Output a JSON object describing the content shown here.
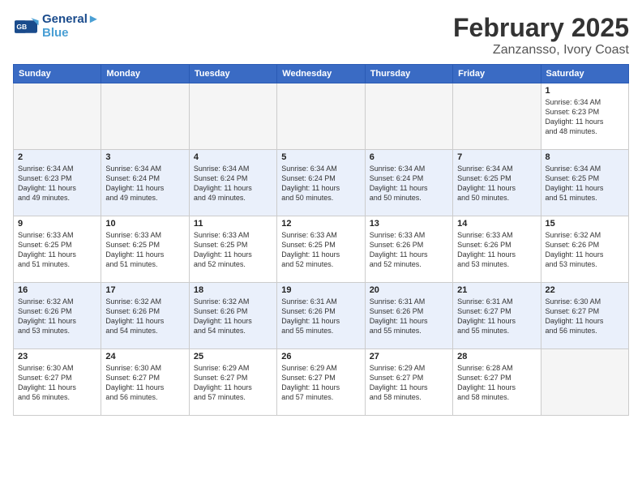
{
  "header": {
    "logo_line1": "General",
    "logo_line2": "Blue",
    "title": "February 2025",
    "subtitle": "Zanzansso, Ivory Coast"
  },
  "days_of_week": [
    "Sunday",
    "Monday",
    "Tuesday",
    "Wednesday",
    "Thursday",
    "Friday",
    "Saturday"
  ],
  "weeks": [
    [
      {
        "num": "",
        "info": "",
        "empty": true
      },
      {
        "num": "",
        "info": "",
        "empty": true
      },
      {
        "num": "",
        "info": "",
        "empty": true
      },
      {
        "num": "",
        "info": "",
        "empty": true
      },
      {
        "num": "",
        "info": "",
        "empty": true
      },
      {
        "num": "",
        "info": "",
        "empty": true
      },
      {
        "num": "1",
        "info": "Sunrise: 6:34 AM\nSunset: 6:23 PM\nDaylight: 11 hours\nand 48 minutes.",
        "empty": false
      }
    ],
    [
      {
        "num": "2",
        "info": "Sunrise: 6:34 AM\nSunset: 6:23 PM\nDaylight: 11 hours\nand 49 minutes.",
        "empty": false
      },
      {
        "num": "3",
        "info": "Sunrise: 6:34 AM\nSunset: 6:24 PM\nDaylight: 11 hours\nand 49 minutes.",
        "empty": false
      },
      {
        "num": "4",
        "info": "Sunrise: 6:34 AM\nSunset: 6:24 PM\nDaylight: 11 hours\nand 49 minutes.",
        "empty": false
      },
      {
        "num": "5",
        "info": "Sunrise: 6:34 AM\nSunset: 6:24 PM\nDaylight: 11 hours\nand 50 minutes.",
        "empty": false
      },
      {
        "num": "6",
        "info": "Sunrise: 6:34 AM\nSunset: 6:24 PM\nDaylight: 11 hours\nand 50 minutes.",
        "empty": false
      },
      {
        "num": "7",
        "info": "Sunrise: 6:34 AM\nSunset: 6:25 PM\nDaylight: 11 hours\nand 50 minutes.",
        "empty": false
      },
      {
        "num": "8",
        "info": "Sunrise: 6:34 AM\nSunset: 6:25 PM\nDaylight: 11 hours\nand 51 minutes.",
        "empty": false
      }
    ],
    [
      {
        "num": "9",
        "info": "Sunrise: 6:33 AM\nSunset: 6:25 PM\nDaylight: 11 hours\nand 51 minutes.",
        "empty": false
      },
      {
        "num": "10",
        "info": "Sunrise: 6:33 AM\nSunset: 6:25 PM\nDaylight: 11 hours\nand 51 minutes.",
        "empty": false
      },
      {
        "num": "11",
        "info": "Sunrise: 6:33 AM\nSunset: 6:25 PM\nDaylight: 11 hours\nand 52 minutes.",
        "empty": false
      },
      {
        "num": "12",
        "info": "Sunrise: 6:33 AM\nSunset: 6:25 PM\nDaylight: 11 hours\nand 52 minutes.",
        "empty": false
      },
      {
        "num": "13",
        "info": "Sunrise: 6:33 AM\nSunset: 6:26 PM\nDaylight: 11 hours\nand 52 minutes.",
        "empty": false
      },
      {
        "num": "14",
        "info": "Sunrise: 6:33 AM\nSunset: 6:26 PM\nDaylight: 11 hours\nand 53 minutes.",
        "empty": false
      },
      {
        "num": "15",
        "info": "Sunrise: 6:32 AM\nSunset: 6:26 PM\nDaylight: 11 hours\nand 53 minutes.",
        "empty": false
      }
    ],
    [
      {
        "num": "16",
        "info": "Sunrise: 6:32 AM\nSunset: 6:26 PM\nDaylight: 11 hours\nand 53 minutes.",
        "empty": false
      },
      {
        "num": "17",
        "info": "Sunrise: 6:32 AM\nSunset: 6:26 PM\nDaylight: 11 hours\nand 54 minutes.",
        "empty": false
      },
      {
        "num": "18",
        "info": "Sunrise: 6:32 AM\nSunset: 6:26 PM\nDaylight: 11 hours\nand 54 minutes.",
        "empty": false
      },
      {
        "num": "19",
        "info": "Sunrise: 6:31 AM\nSunset: 6:26 PM\nDaylight: 11 hours\nand 55 minutes.",
        "empty": false
      },
      {
        "num": "20",
        "info": "Sunrise: 6:31 AM\nSunset: 6:26 PM\nDaylight: 11 hours\nand 55 minutes.",
        "empty": false
      },
      {
        "num": "21",
        "info": "Sunrise: 6:31 AM\nSunset: 6:27 PM\nDaylight: 11 hours\nand 55 minutes.",
        "empty": false
      },
      {
        "num": "22",
        "info": "Sunrise: 6:30 AM\nSunset: 6:27 PM\nDaylight: 11 hours\nand 56 minutes.",
        "empty": false
      }
    ],
    [
      {
        "num": "23",
        "info": "Sunrise: 6:30 AM\nSunset: 6:27 PM\nDaylight: 11 hours\nand 56 minutes.",
        "empty": false
      },
      {
        "num": "24",
        "info": "Sunrise: 6:30 AM\nSunset: 6:27 PM\nDaylight: 11 hours\nand 56 minutes.",
        "empty": false
      },
      {
        "num": "25",
        "info": "Sunrise: 6:29 AM\nSunset: 6:27 PM\nDaylight: 11 hours\nand 57 minutes.",
        "empty": false
      },
      {
        "num": "26",
        "info": "Sunrise: 6:29 AM\nSunset: 6:27 PM\nDaylight: 11 hours\nand 57 minutes.",
        "empty": false
      },
      {
        "num": "27",
        "info": "Sunrise: 6:29 AM\nSunset: 6:27 PM\nDaylight: 11 hours\nand 58 minutes.",
        "empty": false
      },
      {
        "num": "28",
        "info": "Sunrise: 6:28 AM\nSunset: 6:27 PM\nDaylight: 11 hours\nand 58 minutes.",
        "empty": false
      },
      {
        "num": "",
        "info": "",
        "empty": true
      }
    ]
  ]
}
